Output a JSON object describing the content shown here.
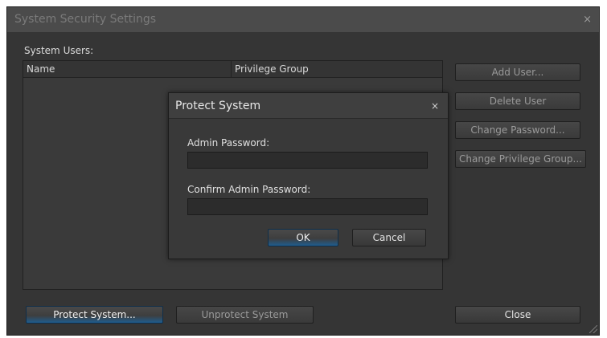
{
  "window": {
    "title": "System Security Settings",
    "close_glyph": "×"
  },
  "users": {
    "label": "System Users:",
    "columns": [
      "Name",
      "Privilege Group"
    ],
    "rows": []
  },
  "side_buttons": {
    "add_user": "Add User...",
    "delete_user": "Delete User",
    "change_password": "Change Password...",
    "change_privilege_group": "Change Privilege Group..."
  },
  "bottom_buttons": {
    "protect_system": "Protect System...",
    "unprotect_system": "Unprotect System",
    "close": "Close"
  },
  "dialog": {
    "title": "Protect System",
    "close_glyph": "×",
    "admin_password_label": "Admin Password:",
    "admin_password_value": "",
    "confirm_password_label": "Confirm Admin Password:",
    "confirm_password_value": "",
    "ok": "OK",
    "cancel": "Cancel"
  },
  "colors": {
    "window_bg": "#353535",
    "titlebar_bg": "#4b4b4b",
    "accent_blue": "#1f5d8e"
  }
}
